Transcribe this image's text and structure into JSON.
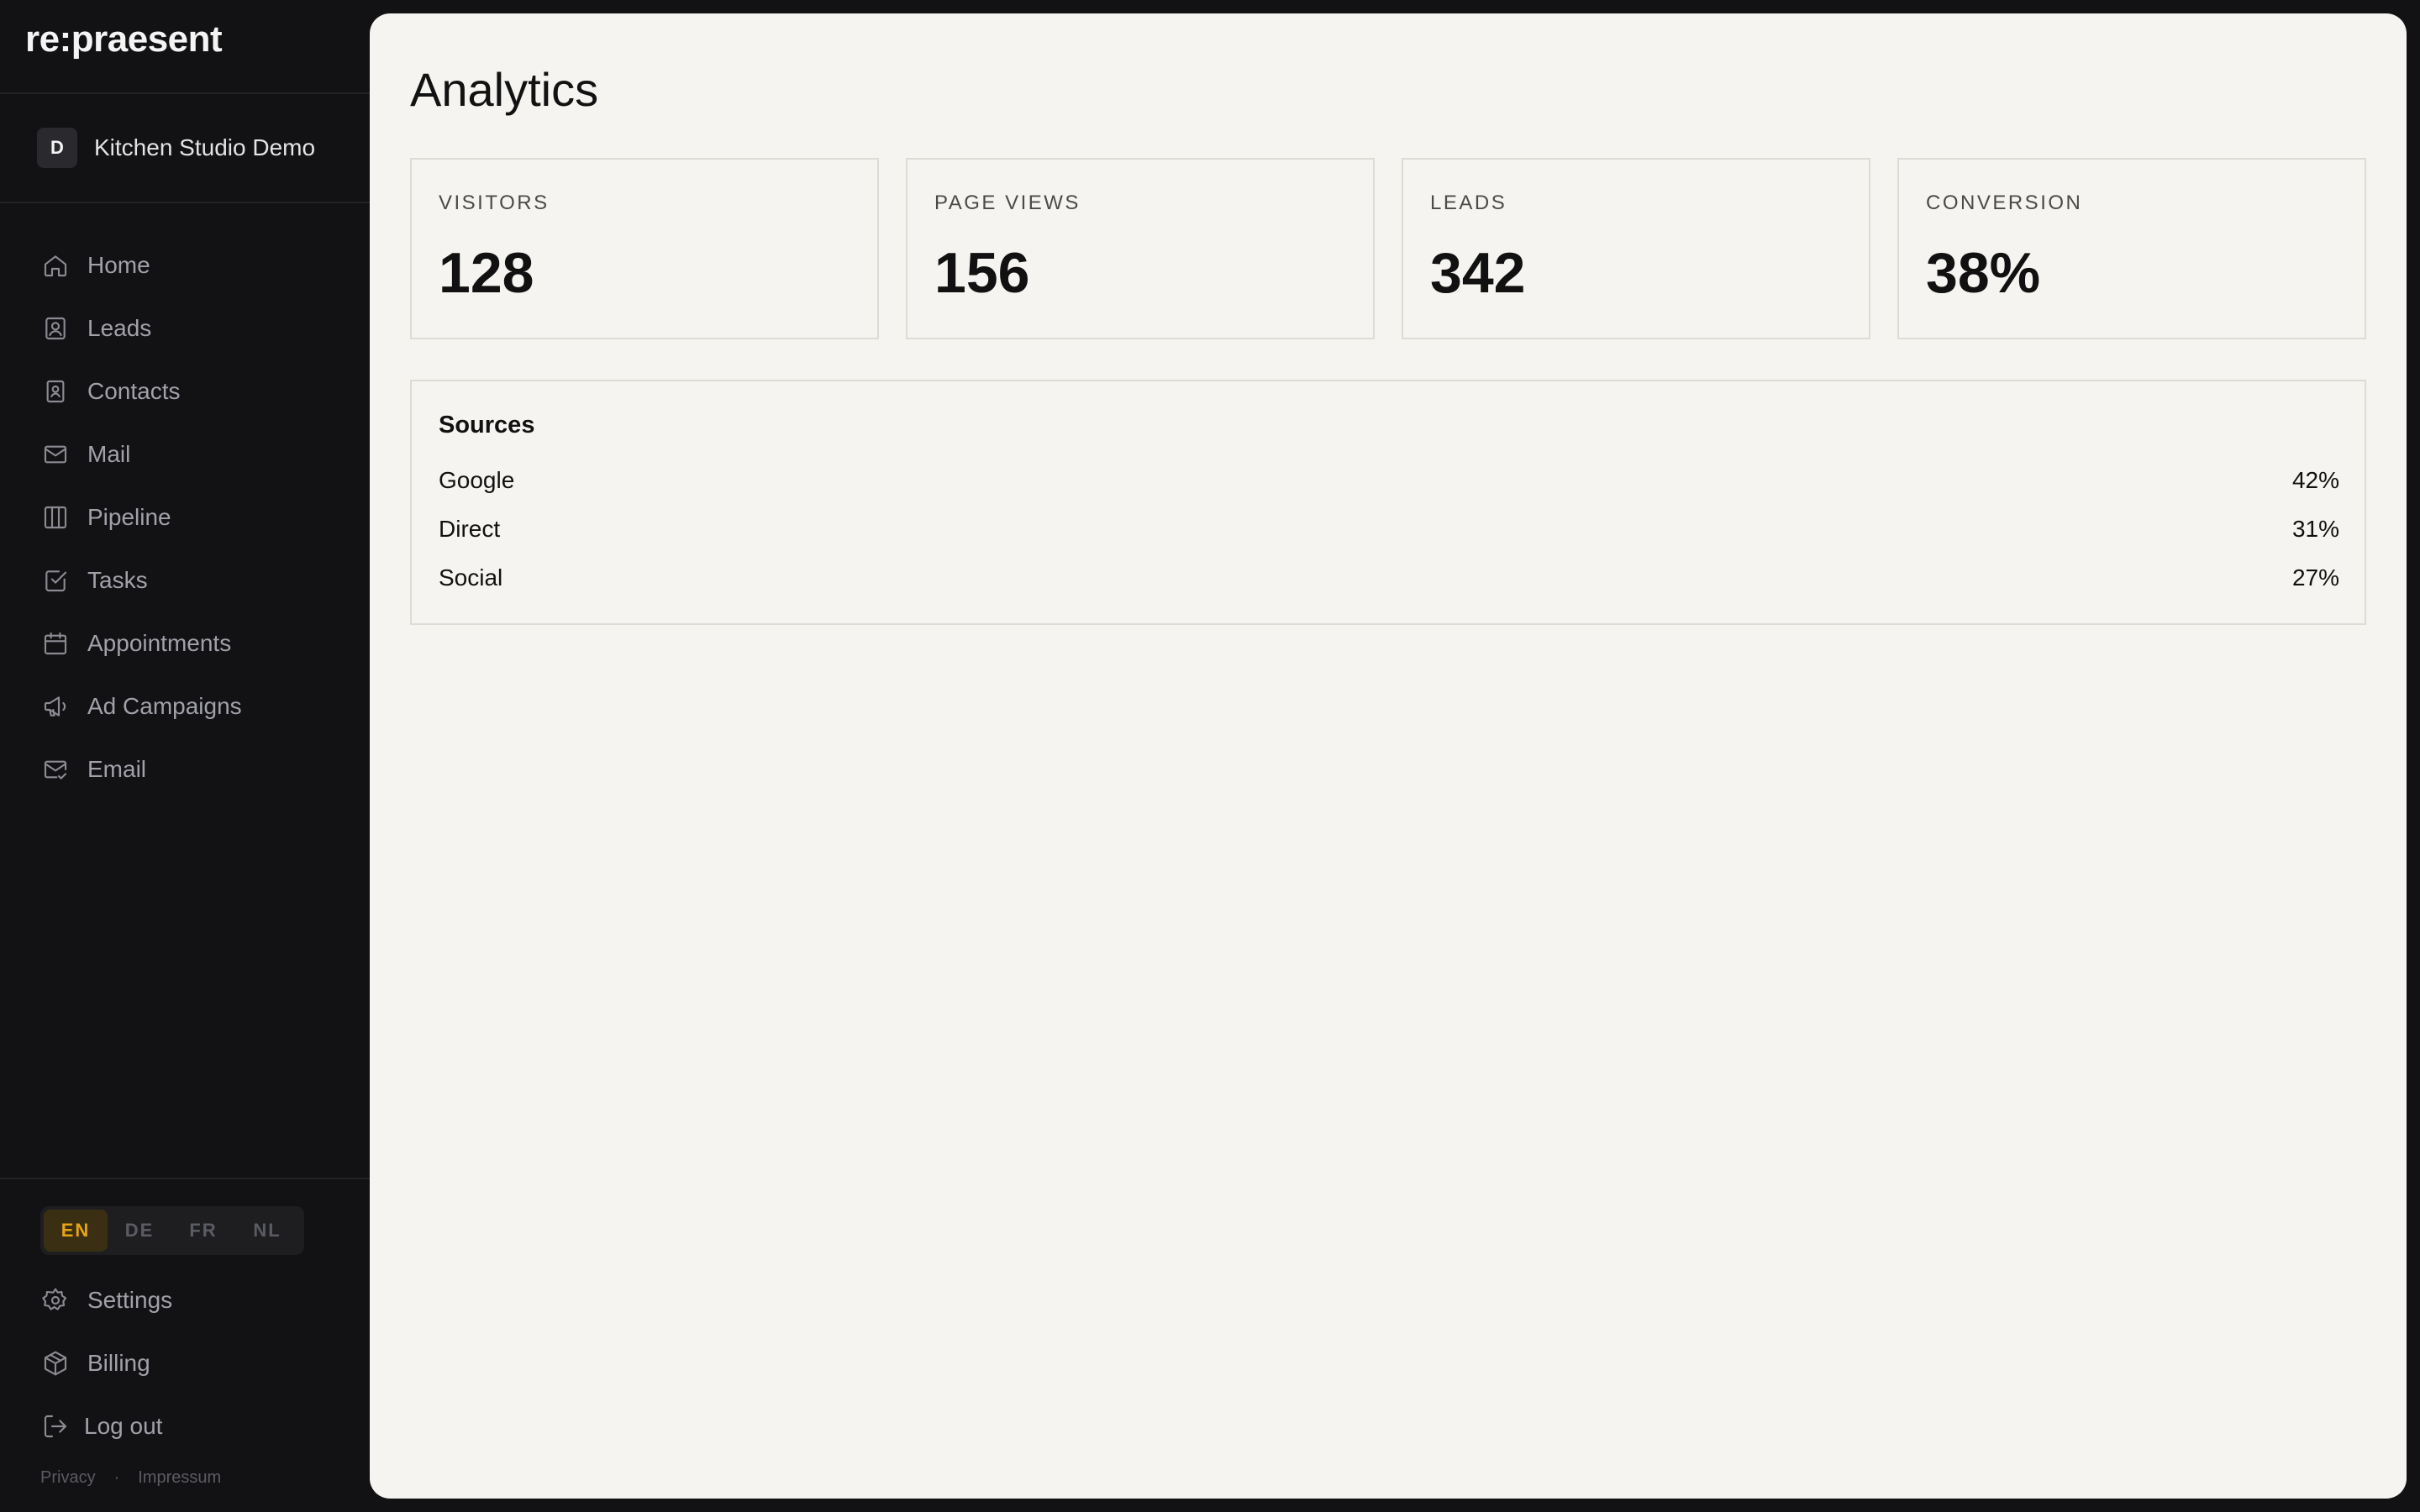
{
  "brand": {
    "logo": "re:praesent"
  },
  "workspace": {
    "badge": "D",
    "name": "Kitchen Studio Demo"
  },
  "nav": [
    {
      "label": "Home",
      "icon": "home-icon"
    },
    {
      "label": "Leads",
      "icon": "lead-icon"
    },
    {
      "label": "Contacts",
      "icon": "contacts-icon"
    },
    {
      "label": "Mail",
      "icon": "mail-icon"
    },
    {
      "label": "Pipeline",
      "icon": "pipeline-icon"
    },
    {
      "label": "Tasks",
      "icon": "tasks-icon"
    },
    {
      "label": "Appointments",
      "icon": "calendar-icon"
    },
    {
      "label": "Ad Campaigns",
      "icon": "megaphone-icon"
    },
    {
      "label": "Email",
      "icon": "email-check-icon"
    }
  ],
  "languages": {
    "items": [
      "EN",
      "DE",
      "FR",
      "NL"
    ],
    "active": "EN"
  },
  "bottom_nav": [
    {
      "label": "Settings",
      "icon": "gear-icon"
    },
    {
      "label": "Billing",
      "icon": "box-icon"
    },
    {
      "label": "Log out",
      "icon": "logout-icon"
    }
  ],
  "footer": {
    "privacy": "Privacy",
    "separator": "·",
    "impressum": "Impressum"
  },
  "main": {
    "title": "Analytics",
    "stats": [
      {
        "label": "VISITORS",
        "value": "128"
      },
      {
        "label": "PAGE VIEWS",
        "value": "156"
      },
      {
        "label": "LEADS",
        "value": "342"
      },
      {
        "label": "CONVERSION",
        "value": "38%"
      }
    ],
    "sources": {
      "title": "Sources",
      "rows": [
        {
          "name": "Google",
          "value": "42%"
        },
        {
          "name": "Direct",
          "value": "31%"
        },
        {
          "name": "Social",
          "value": "27%"
        }
      ]
    }
  },
  "colors": {
    "sidebar_bg": "#121214",
    "main_bg": "#f5f4f0",
    "accent": "#e8a317",
    "accent_bg": "#3a2f12"
  }
}
